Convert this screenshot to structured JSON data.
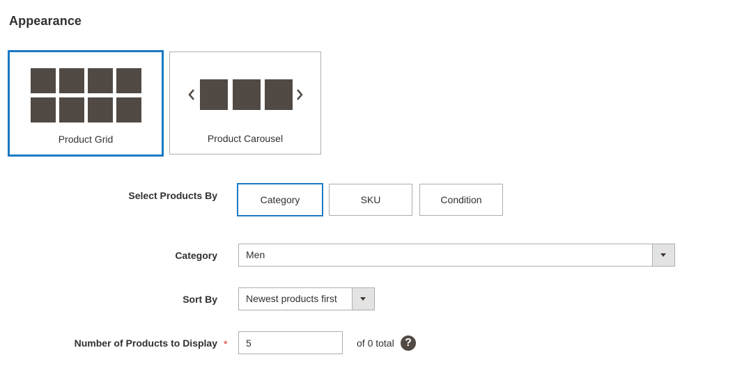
{
  "section": {
    "title": "Appearance"
  },
  "appearance": {
    "options": [
      {
        "label": "Product Grid",
        "icon": "grid-icon",
        "selected": true
      },
      {
        "label": "Product Carousel",
        "icon": "carousel-icon",
        "selected": false
      }
    ]
  },
  "select_products_by": {
    "label": "Select Products By",
    "options": [
      "Category",
      "SKU",
      "Condition"
    ],
    "selected": "Category"
  },
  "category": {
    "label": "Category",
    "value": "Men"
  },
  "sort_by": {
    "label": "Sort By",
    "value": "Newest products first"
  },
  "products_count": {
    "label": "Number of Products to Display",
    "required_mark": "*",
    "value": "5",
    "total_text": "of 0 total",
    "help_icon": "?"
  },
  "colors": {
    "accent": "#1979c3",
    "icon_fill": "#514943",
    "required": "#e22626",
    "border": "#adadad"
  }
}
